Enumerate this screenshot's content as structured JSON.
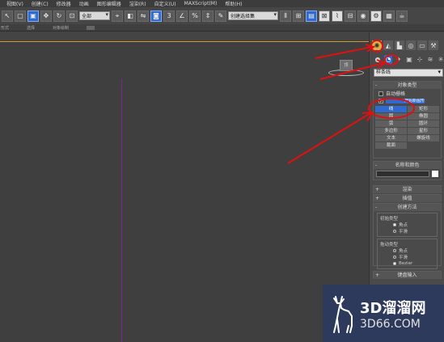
{
  "menubar": {
    "items": [
      "视图(V)",
      "创建(C)",
      "修改器",
      "动画",
      "图形编辑器",
      "渲染(R)",
      "自定义(U)",
      "MAXScript(M)",
      "帮助(H)"
    ]
  },
  "toolbar": {
    "filter_value": "全部",
    "selection_set": "创建选择集"
  },
  "ribbon": {
    "labels": [
      "形式",
      "选择",
      "对象绘制"
    ]
  },
  "viewport": {
    "gizmo_label": "顶"
  },
  "panel": {
    "category_value": "样条线",
    "object_type_title": "对象类型",
    "auto_grid_label": "自动栅格",
    "start_new_shape_label": "开始新图形",
    "object_buttons": [
      "线",
      "矩形",
      "圆",
      "椭圆",
      "弧",
      "圆环",
      "多边形",
      "星形",
      "文本",
      "螺旋线",
      "截面",
      ""
    ],
    "name_color_title": "名称和颜色",
    "rendering_title": "渲染",
    "interpolation_title": "插值",
    "creation_method_title": "创建方法",
    "initial_type_label": "初始类型",
    "initial_options": [
      "角点",
      "平滑"
    ],
    "drag_type_label": "拖动类型",
    "drag_options": [
      "角点",
      "平滑",
      "Bezier"
    ],
    "keyboard_entry_title": "键盘输入",
    "selected_button": "线"
  },
  "watermark": {
    "title": "3D溜溜网",
    "url": "3D66.COM"
  },
  "colors": {
    "accent_blue": "#2f6ad0",
    "annotation_red": "#e01010",
    "active_tab_gold": "#d8b04a"
  },
  "icons": [
    "select-arrow-icon",
    "move-icon",
    "rotate-icon",
    "scale-icon",
    "create-tab-icon",
    "modify-tab-icon",
    "hierarchy-tab-icon",
    "motion-tab-icon",
    "display-tab-icon",
    "utilities-tab-icon",
    "shapes-subtab-icon",
    "teapot-render-icon"
  ]
}
